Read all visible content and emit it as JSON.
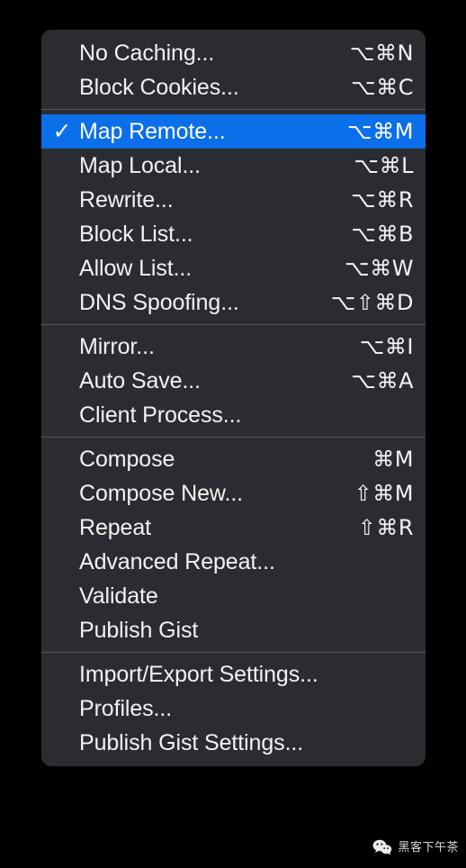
{
  "menu": {
    "sections": [
      {
        "items": [
          {
            "label": "No Caching...",
            "shortcut": "⌥⌘N",
            "checked": false,
            "selected": false
          },
          {
            "label": "Block Cookies...",
            "shortcut": "⌥⌘C",
            "checked": false,
            "selected": false
          }
        ]
      },
      {
        "items": [
          {
            "label": "Map Remote...",
            "shortcut": "⌥⌘M",
            "checked": true,
            "selected": true
          },
          {
            "label": "Map Local...",
            "shortcut": "⌥⌘L",
            "checked": false,
            "selected": false
          },
          {
            "label": "Rewrite...",
            "shortcut": "⌥⌘R",
            "checked": false,
            "selected": false
          },
          {
            "label": "Block List...",
            "shortcut": "⌥⌘B",
            "checked": false,
            "selected": false
          },
          {
            "label": "Allow List...",
            "shortcut": "⌥⌘W",
            "checked": false,
            "selected": false
          },
          {
            "label": "DNS Spoofing...",
            "shortcut": "⌥⇧⌘D",
            "checked": false,
            "selected": false
          }
        ]
      },
      {
        "items": [
          {
            "label": "Mirror...",
            "shortcut": "⌥⌘I",
            "checked": false,
            "selected": false
          },
          {
            "label": "Auto Save...",
            "shortcut": "⌥⌘A",
            "checked": false,
            "selected": false
          },
          {
            "label": "Client Process...",
            "shortcut": "",
            "checked": false,
            "selected": false
          }
        ]
      },
      {
        "items": [
          {
            "label": "Compose",
            "shortcut": "⌘M",
            "checked": false,
            "selected": false
          },
          {
            "label": "Compose New...",
            "shortcut": "⇧⌘M",
            "checked": false,
            "selected": false
          },
          {
            "label": "Repeat",
            "shortcut": "⇧⌘R",
            "checked": false,
            "selected": false
          },
          {
            "label": "Advanced Repeat...",
            "shortcut": "",
            "checked": false,
            "selected": false
          },
          {
            "label": "Validate",
            "shortcut": "",
            "checked": false,
            "selected": false
          },
          {
            "label": "Publish Gist",
            "shortcut": "",
            "checked": false,
            "selected": false
          }
        ]
      },
      {
        "items": [
          {
            "label": "Import/Export Settings...",
            "shortcut": "",
            "checked": false,
            "selected": false
          },
          {
            "label": "Profiles...",
            "shortcut": "",
            "checked": false,
            "selected": false
          },
          {
            "label": "Publish Gist Settings...",
            "shortcut": "",
            "checked": false,
            "selected": false
          }
        ]
      }
    ],
    "check_glyph": "✓",
    "colors": {
      "menu_background": "#2a2c31",
      "selected_background": "#0a6fe8",
      "text": "#f2f2f3",
      "separator": "#54565b",
      "page_background": "#000000"
    }
  },
  "watermark": {
    "icon": "wechat-icon",
    "text": "黑客下午茶"
  }
}
